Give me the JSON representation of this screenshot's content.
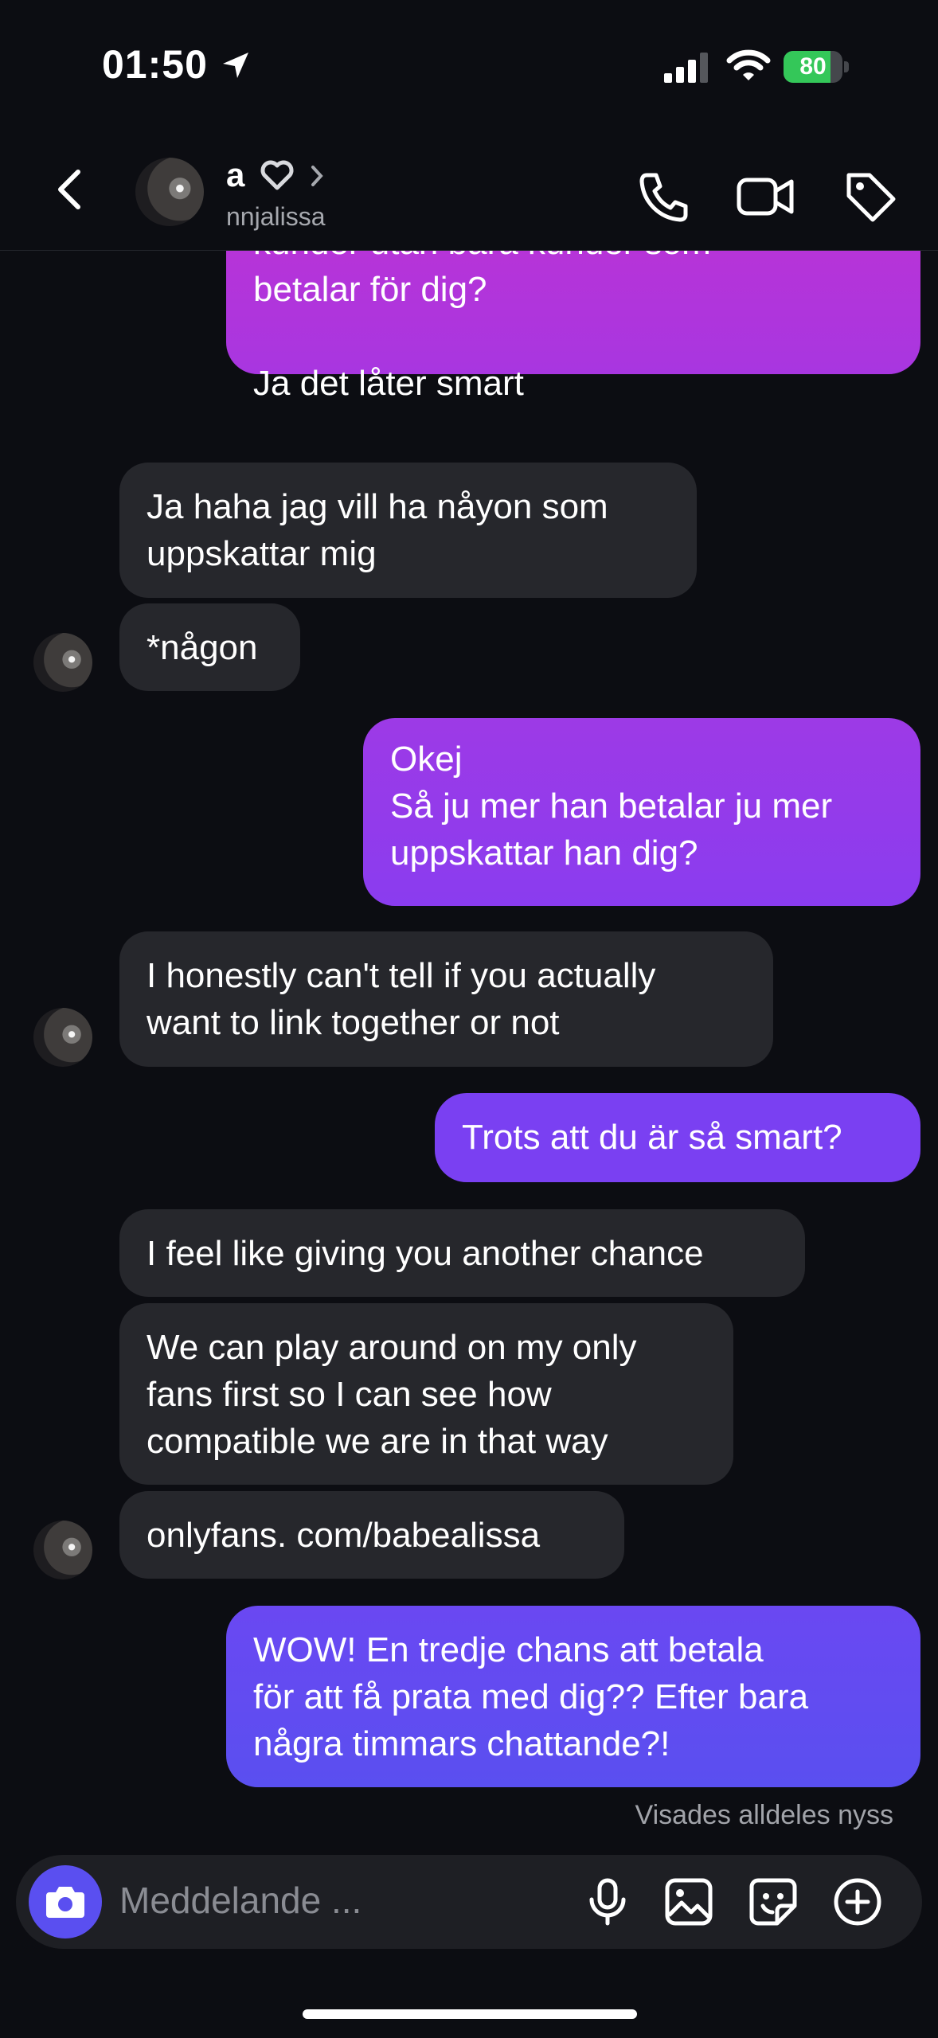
{
  "status_bar": {
    "time": "01:50",
    "battery": "80",
    "battery_level": 0.8,
    "battery_color": "#34c759"
  },
  "header": {
    "name": "a",
    "username": "nnjalissa",
    "icons": [
      "back-icon",
      "heart-icon",
      "chevron-right-icon",
      "phone-icon",
      "video-icon",
      "tag-icon"
    ]
  },
  "messages": [
    {
      "side": "out",
      "text": "kunder utan bara kunder som\nbetalar för dig?\n\nJa det låter smart"
    },
    {
      "side": "in",
      "text": "Ja haha jag vill ha nåyon som\nuppskattar mig"
    },
    {
      "side": "in",
      "text": "*någon"
    },
    {
      "side": "out",
      "text": "Okej\nSå ju mer han betalar ju mer\nuppskattar han dig?"
    },
    {
      "side": "in",
      "text": "I honestly can't tell if you actually\nwant to link together or not"
    },
    {
      "side": "out",
      "text": "Trots att du är så smart?"
    },
    {
      "side": "in",
      "text": "I feel like giving you another chance"
    },
    {
      "side": "in",
      "text": "We can play around on my only\nfans first so I can see how\ncompatible we are in that way"
    },
    {
      "side": "in",
      "text": "onlyfans. com/babealissa"
    },
    {
      "side": "out",
      "text": "WOW! En tredje chans att betala\nför att få prata med dig?? Efter bara\nnågra timmars chattande?!"
    }
  ],
  "seen_status": "Visades alldeles nyss",
  "composer": {
    "placeholder": "Meddelande ...",
    "icons": [
      "camera-icon",
      "microphone-icon",
      "gallery-icon",
      "sticker-icon",
      "plus-icon"
    ]
  },
  "colors": {
    "background": "#0c0d12",
    "incoming_bubble": "#26272c",
    "outgoing_top": "#b232d9",
    "outgoing_bottom": "#5a4ff0",
    "accent": "#5a4ff0"
  }
}
